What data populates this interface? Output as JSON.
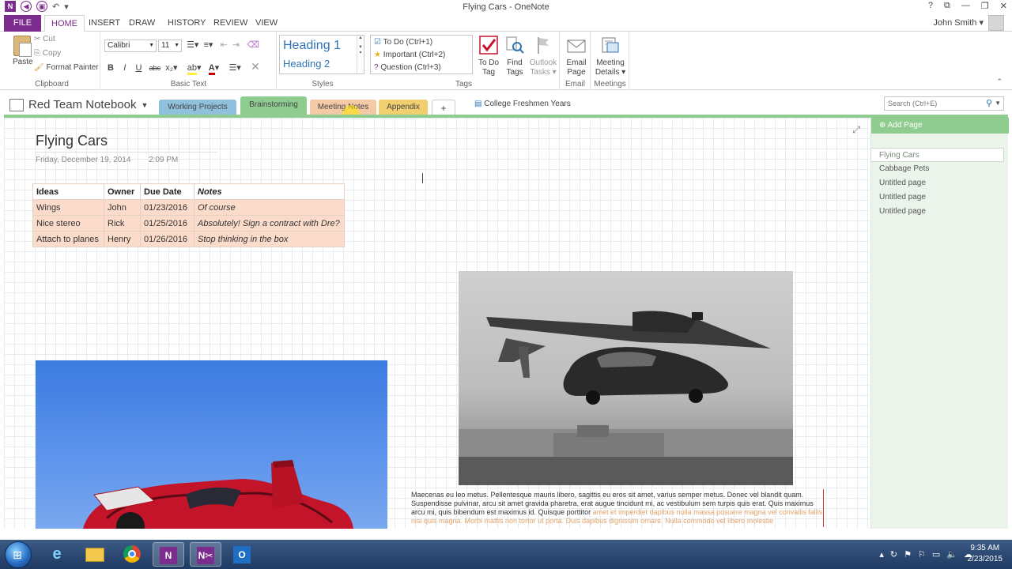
{
  "window": {
    "title": "Flying Cars - OneNote",
    "controls": [
      "?",
      "⧉",
      "—",
      "❐",
      "✕"
    ]
  },
  "quick_access": {
    "logo": "N",
    "undo": "↶"
  },
  "ribbon_tabs": {
    "file": "FILE",
    "home": "HOME",
    "insert": "INSERT",
    "draw": "DRAW",
    "history": "HISTORY",
    "review": "REVIEW",
    "view": "VIEW"
  },
  "user": {
    "name": "John Smith ▾"
  },
  "clipboard": {
    "paste": "Paste",
    "cut": "Cut",
    "copy": "Copy",
    "format_painter": "Format Painter",
    "label": "Clipboard"
  },
  "basic_text": {
    "font": "Calibri",
    "size": "11",
    "label": "Basic Text",
    "bold": "B",
    "italic": "I",
    "underline": "U",
    "strike": "abc",
    "sub": "x₂",
    "highlight": "ab",
    "fontcolor": "A"
  },
  "styles": {
    "heading1": "Heading 1",
    "heading2": "Heading 2",
    "label": "Styles"
  },
  "tags": {
    "items": [
      {
        "icon": "☑",
        "label": "To Do (Ctrl+1)"
      },
      {
        "icon": "★",
        "label": "Important (Ctrl+2)"
      },
      {
        "icon": "?",
        "label": "Question (Ctrl+3)"
      }
    ],
    "todo_tag": "To Do\nTag",
    "todo_tag_line1": "To Do",
    "todo_tag_line2": "Tag",
    "find_tags_line1": "Find",
    "find_tags_line2": "Tags",
    "outlook_line1": "Outlook",
    "outlook_line2": "Tasks ▾",
    "label": "Tags"
  },
  "email": {
    "line1": "Email",
    "line2": "Page",
    "label": "Email"
  },
  "meetings": {
    "line1": "Meeting",
    "line2": "Details ▾",
    "label": "Meetings"
  },
  "notebook": {
    "name": "Red Team Notebook",
    "sections": [
      {
        "label": "Working Projects",
        "color": "#8fc0dc"
      },
      {
        "label": "Brainstorming",
        "color": "#8fcc8f"
      },
      {
        "label": "Meeting Notes",
        "color": "#f3c9a6"
      },
      {
        "label": "Appendix",
        "color": "#f2cf6e"
      }
    ],
    "add_section": "+",
    "other_notebook": "College Freshmen Years"
  },
  "search": {
    "placeholder": "Search (Ctrl+E)"
  },
  "page": {
    "title": "Flying Cars",
    "date": "Friday, December 19, 2014",
    "time": "2:09 PM",
    "table": {
      "headers": [
        "Ideas",
        "Owner",
        "Due Date",
        "Notes"
      ],
      "rows": [
        [
          "Wings",
          "John",
          "01/23/2016",
          "Of course"
        ],
        [
          "Nice stereo",
          "Rick",
          "01/25/2016",
          "Absolutely! Sign a contract with Dre?"
        ],
        [
          "Attach to planes",
          "Henry",
          "01/26/2016",
          "Stop thinking in the box"
        ]
      ]
    },
    "caption_main": "Maecenas eu leo metus. Pellentesque mauris libero, sagittis eu eros sit amet, varius semper metus. Donec vel blandit quam. Suspendisse pulvinar, arcu sit amet gravida pharetra, erat augue tincidunt mi, ac vestibulum sem turpis quis erat. Quis maximus arcu mi, quis bibendum est maximus id. Quisque porttitor",
    "caption_faded": "amet et imperdiet dapibus nulla massa posuere magna vel convallis fallis nisi quis magna. Morbi mattis non tortor ut porta. Duis dapibus dignissim ornare. Nulla commodo vel libero molestie"
  },
  "pages_pane": {
    "add_page": "Add Page",
    "pages": [
      "Flying Cars",
      "Cabbage Pets",
      "Untitled page",
      "Untitled page",
      "Untitled page"
    ]
  },
  "taskbar": {
    "clock_time": "9:35 AM",
    "clock_date": "2/23/2015"
  },
  "colors": {
    "accent": "#7b2c8c",
    "section_green": "#8fcc8f",
    "table_fill": "#fbdcca",
    "heading_blue": "#2e74b5"
  }
}
